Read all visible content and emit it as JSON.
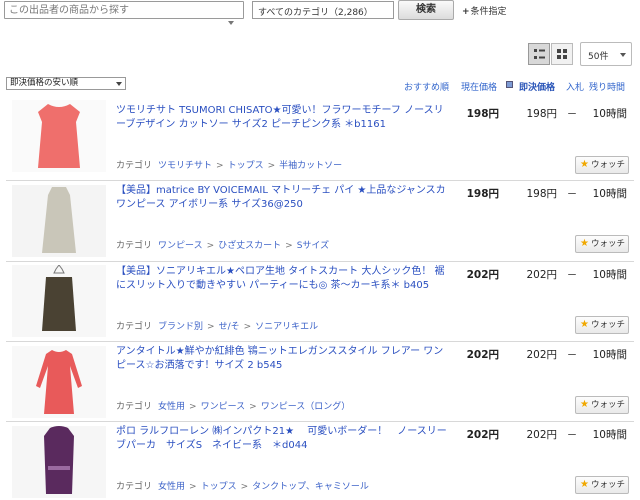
{
  "search": {
    "placeholder": "この出品者の商品から探す",
    "category": "すべてのカテゴリ（2,286）",
    "button": "検索",
    "conditions": "条件指定"
  },
  "view": {
    "per_page": "50件"
  },
  "sort": {
    "selected": "即決価格の安い順",
    "links": [
      "おすすめ順",
      "現在価格",
      "即決価格",
      "入札",
      "残り時間"
    ]
  },
  "category_label": "カテゴリ",
  "watch_label": "ウォッチ",
  "items": [
    {
      "title": "ツモリチサト TSUMORI CHISATO★可愛い！フラワーモチーフ ノースリーブデザイン カットソー サイズ2 ピーチピンク系 ＊b1161",
      "categories": [
        "ツモリチサト",
        "トップス",
        "半袖カットソー"
      ],
      "price": "198円",
      "buyout": "198円",
      "bids": "－",
      "remaining": "10時間",
      "garment_color": "#ef6f6c"
    },
    {
      "title": "【美品】matrice BY VOICEMAIL マトリーチェ パイ ★上品なジャンスカ ワンピース アイボリー系 サイズ36@250",
      "categories": [
        "ワンピース",
        "ひざ丈スカート",
        "Sサイズ"
      ],
      "price": "198円",
      "buyout": "198円",
      "bids": "－",
      "remaining": "10時間",
      "garment_color": "#c9c6b9"
    },
    {
      "title": "【美品】ソニアリキエル★ペロア生地 タイトスカート 大人シック色！ 裾にスリット入りで動きやすい パーティーにも◎ 茶～カーキ系＊ b405",
      "categories": [
        "ブランド別",
        "せ/そ",
        "ソニアリキエル"
      ],
      "price": "202円",
      "buyout": "202円",
      "bids": "－",
      "remaining": "10時間",
      "garment_color": "#4a4233"
    },
    {
      "title": "アンタイトル★鮮やか紅緋色 鴇ニットエレガンススタイル フレアー ワンピース☆お洒落です！サイズ 2 b545",
      "categories": [
        "女性用",
        "ワンピース",
        "ワンピース（ロング）"
      ],
      "price": "202円",
      "buyout": "202円",
      "bids": "－",
      "remaining": "10時間",
      "garment_color": "#e85a5a"
    },
    {
      "title": "ポロ ラルフローレン ㈱インパクト21★　 可愛いボーダー！　ノースリーブパーカ　サイズS　ネイビー系　＊d044",
      "categories": [
        "女性用",
        "トップス",
        "タンクトップ、キャミソール"
      ],
      "price": "202円",
      "buyout": "202円",
      "bids": "－",
      "remaining": "10時間",
      "garment_color": "#5a2a5e"
    }
  ]
}
